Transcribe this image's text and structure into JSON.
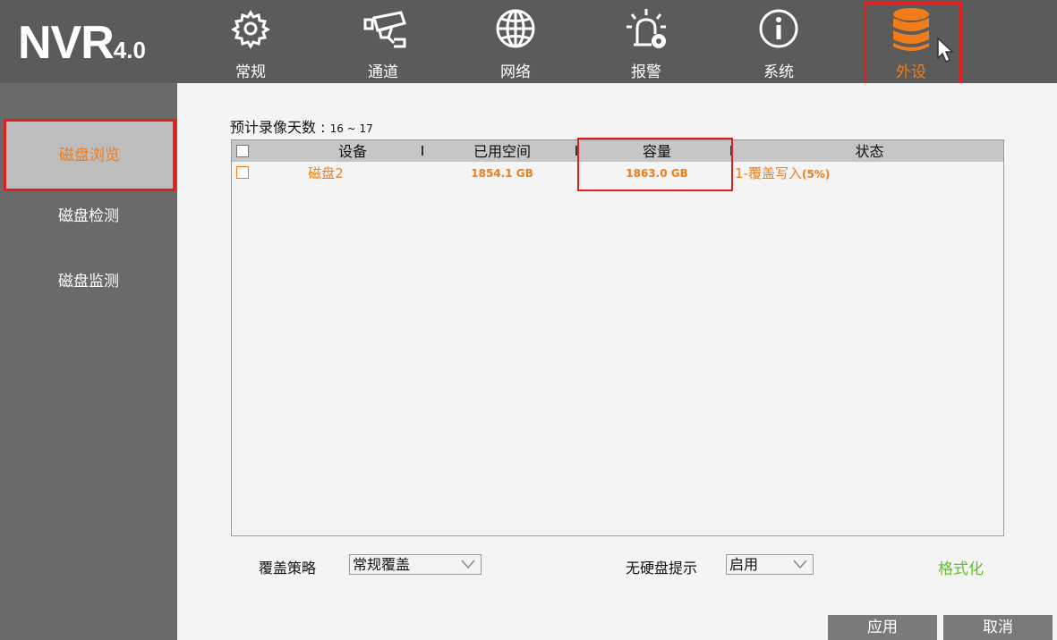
{
  "logo": {
    "text": "NVR",
    "version": "4.0"
  },
  "nav": [
    {
      "label": "常规",
      "icon": "gear-icon"
    },
    {
      "label": "通道",
      "icon": "camera-icon"
    },
    {
      "label": "网络",
      "icon": "globe-icon"
    },
    {
      "label": "报警",
      "icon": "alarm-icon"
    },
    {
      "label": "系统",
      "icon": "info-icon"
    },
    {
      "label": "外设",
      "icon": "database-icon",
      "active": true
    }
  ],
  "sidebar": {
    "items": [
      {
        "label": "磁盘浏览",
        "active": true
      },
      {
        "label": "磁盘检测"
      },
      {
        "label": "磁盘监测"
      }
    ]
  },
  "recording_days": {
    "label": "预计录像天数 :",
    "value": "16 ~ 17"
  },
  "table": {
    "headers": {
      "device": "设备",
      "used": "已用空间",
      "capacity": "容量",
      "status": "状态"
    },
    "rows": [
      {
        "device": "磁盘2",
        "used": "1854.1 GB",
        "capacity": "1863.0 GB",
        "status_text": "1-覆盖写入",
        "status_pct": "(5%)"
      }
    ]
  },
  "overwrite": {
    "label": "覆盖策略",
    "value": "常规覆盖"
  },
  "no_disk": {
    "label": "无硬盘提示",
    "value": "启用"
  },
  "buttons": {
    "format": "格式化",
    "apply": "应用",
    "cancel": "取消"
  },
  "colors": {
    "accent": "#f07d1a",
    "highlight": "#e21f1f",
    "format": "#5fc130",
    "topbar": "#5b5b5b",
    "sidebar": "#6a6a6a"
  }
}
